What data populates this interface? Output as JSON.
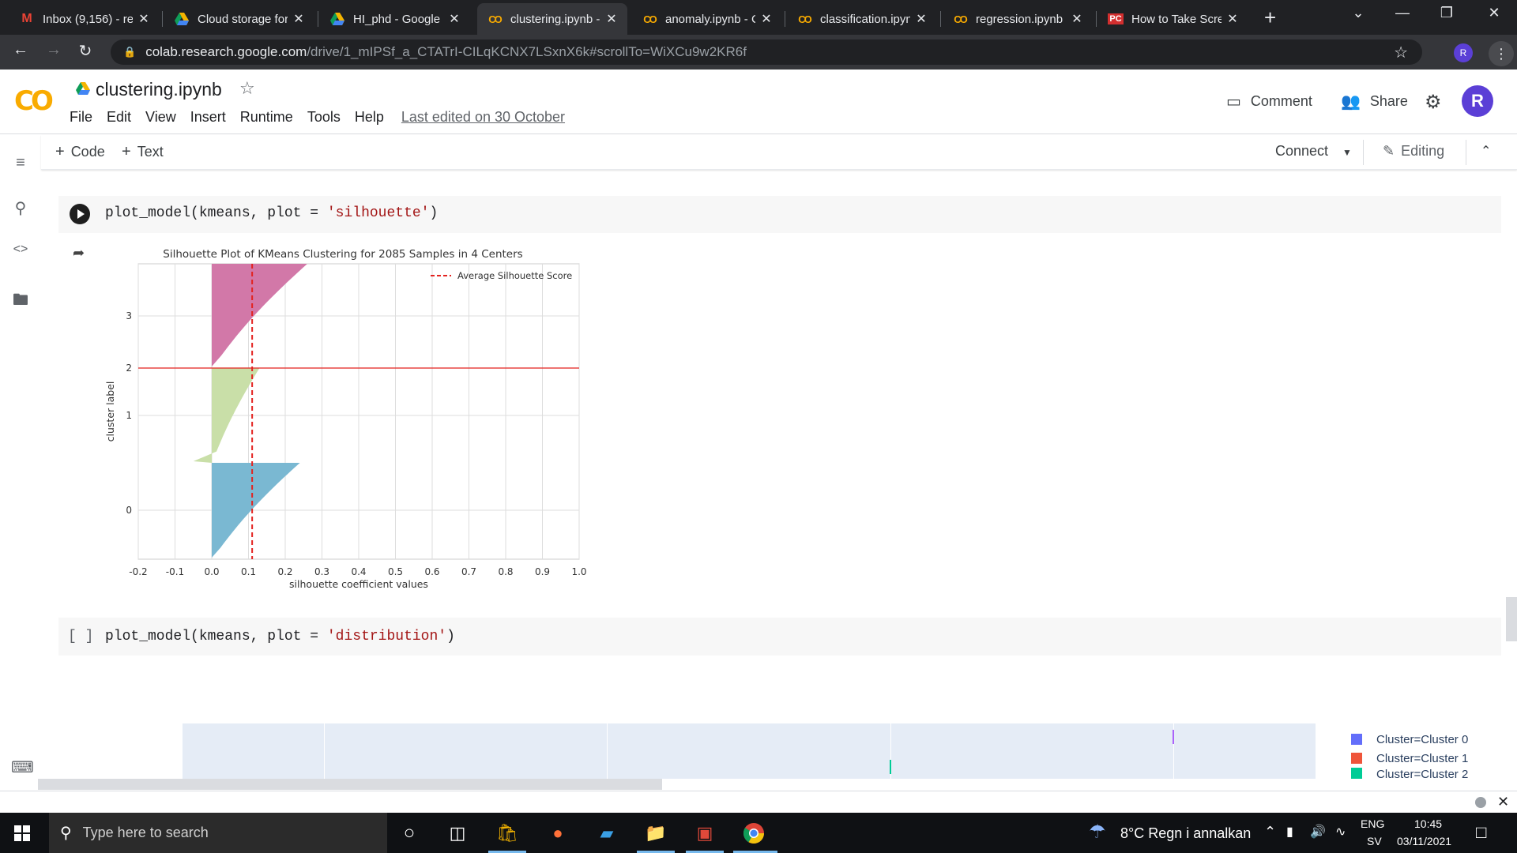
{
  "browser": {
    "tabs": [
      {
        "title": "Inbox (9,156) - re",
        "icon": "gmail-icon",
        "active": false
      },
      {
        "title": "Cloud storage for",
        "icon": "drive-icon",
        "active": false
      },
      {
        "title": "HI_phd - Google",
        "icon": "drive-icon",
        "active": false
      },
      {
        "title": "clustering.ipynb -",
        "icon": "colab-icon",
        "active": true
      },
      {
        "title": "anomaly.ipynb - C",
        "icon": "colab-icon",
        "active": false
      },
      {
        "title": "classification.ipyn",
        "icon": "colab-icon",
        "active": false
      },
      {
        "title": "regression.ipynb",
        "icon": "colab-icon",
        "active": false
      },
      {
        "title": "How to Take Scre",
        "icon": "pc-icon",
        "active": false
      }
    ],
    "url_host": "colab.research.google.com",
    "url_path": "/drive/1_mIPSf_a_CTATrI-CILqKCNX7LSxnX6k#scrollTo=WiXCu9w2KR6f",
    "profile_initial": "R"
  },
  "colab": {
    "logo_text": "CO",
    "notebook_title": "clustering.ipynb",
    "menu": [
      "File",
      "Edit",
      "View",
      "Insert",
      "Runtime",
      "Tools",
      "Help"
    ],
    "last_edited": "Last edited on 30 October",
    "comment_label": "Comment",
    "share_label": "Share",
    "profile_initial": "R",
    "toolbar": {
      "add_code": "Code",
      "add_text": "Text",
      "connect": "Connect",
      "editing": "Editing"
    }
  },
  "cells": [
    {
      "code_prefix": "plot_model(kmeans, plot = ",
      "code_string": "'silhouette'",
      "code_suffix": ")",
      "executed": true
    },
    {
      "code_prefix": "plot_model(kmeans, plot = ",
      "code_string": "'distribution'",
      "code_suffix": ")",
      "executed": false,
      "bracket": "[ ]"
    }
  ],
  "chart_data": {
    "type": "silhouette",
    "title": "Silhouette Plot of KMeans Clustering for 2085 Samples in 4 Centers",
    "xlabel": "silhouette coefficient values",
    "ylabel": "cluster label",
    "xlim": [
      -0.2,
      1.0
    ],
    "xticks": [
      "-0.2",
      "-0.1",
      "0.0",
      "0.1",
      "0.2",
      "0.3",
      "0.4",
      "0.5",
      "0.6",
      "0.7",
      "0.8",
      "0.9",
      "1.0"
    ],
    "yticks": [
      "0",
      "1",
      "2",
      "3"
    ],
    "legend": "Average Silhouette Score",
    "legend_position": "top-right",
    "average_silhouette_score": 0.11,
    "clusters": [
      {
        "label": "0",
        "color": "#7ab8d2",
        "max_value": 0.24,
        "min_value": 0.0
      },
      {
        "label": "1",
        "color": "#c9dfa8",
        "max_value": 0.13,
        "min_value": -0.05
      },
      {
        "label": "3",
        "color": "#d278a8",
        "max_value": 0.26,
        "min_value": 0.0
      }
    ],
    "grid": true
  },
  "distribution_plot": {
    "legend": [
      {
        "label": "Cluster=Cluster 0",
        "color": "#636efa"
      },
      {
        "label": "Cluster=Cluster 1",
        "color": "#ef553b"
      },
      {
        "label": "Cluster=Cluster 2",
        "color": "#00cc96"
      }
    ]
  },
  "taskbar": {
    "search_placeholder": "Type here to search",
    "weather": "8°C  Regn i annalkan",
    "lang_top": "ENG",
    "lang_bottom": "SV",
    "time": "10:45",
    "date": "03/11/2021"
  }
}
